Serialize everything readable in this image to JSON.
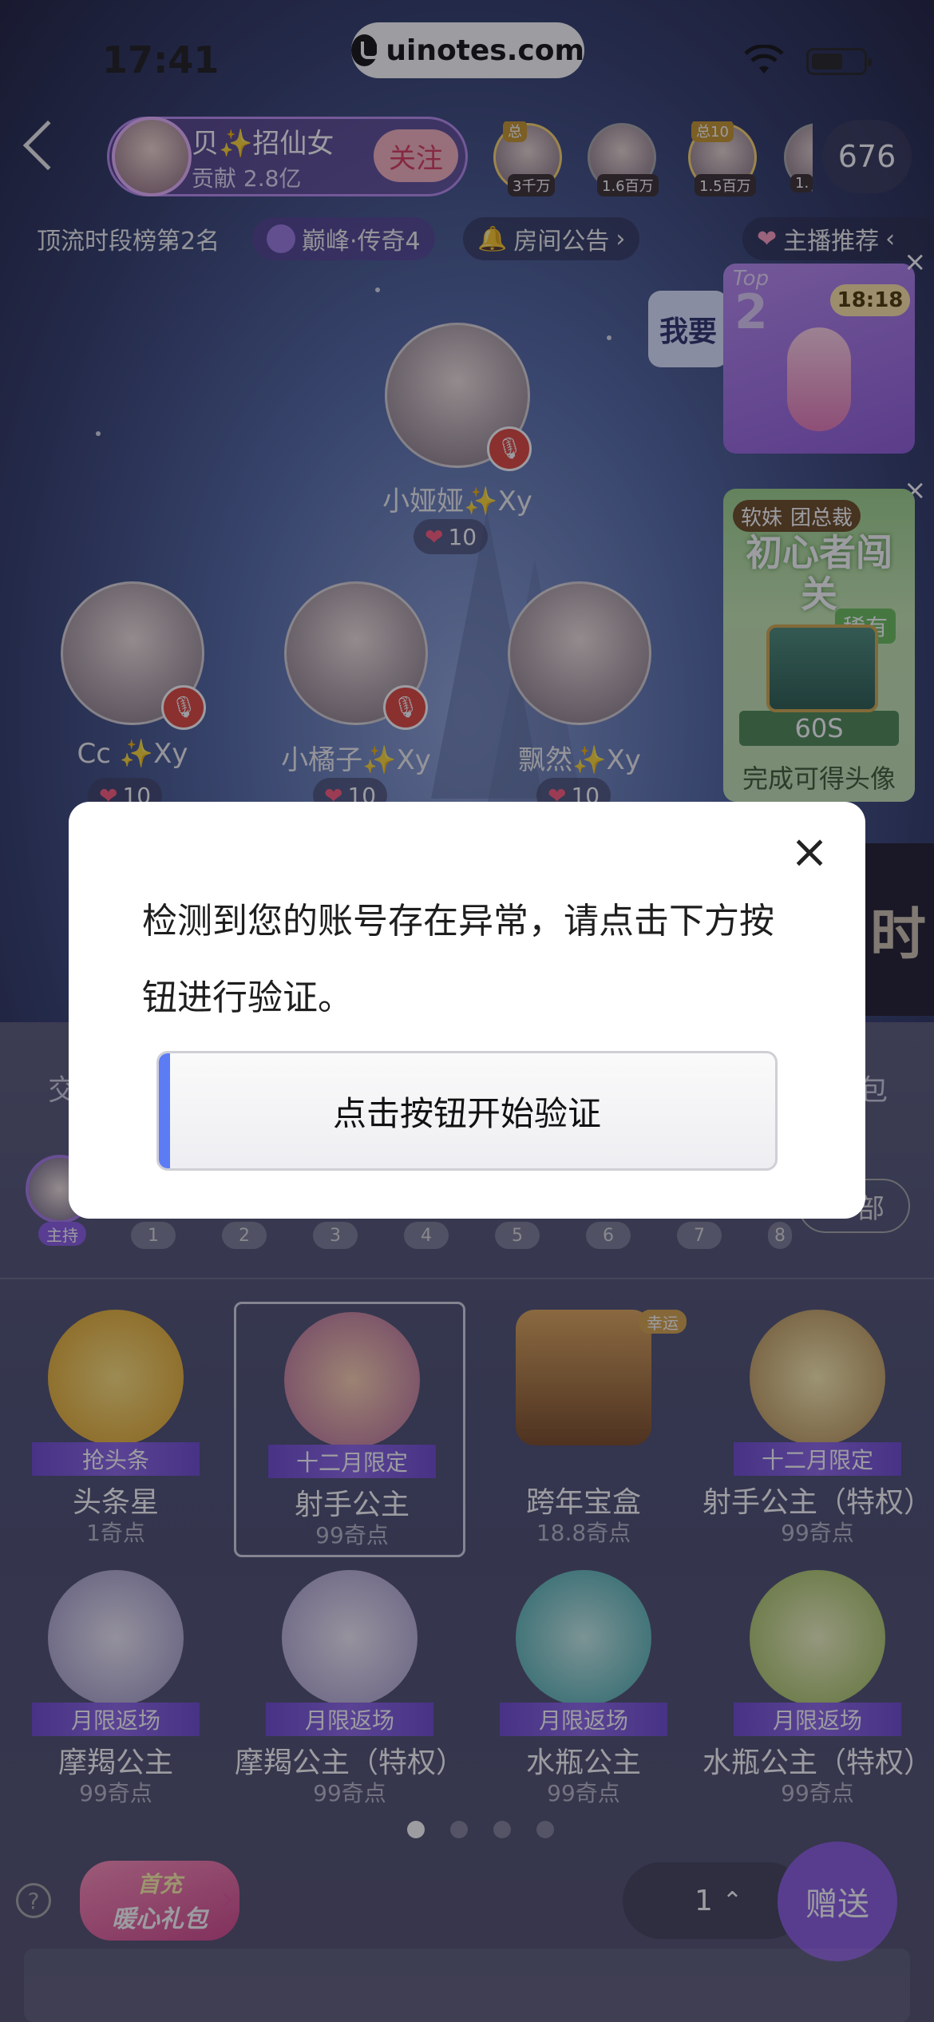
{
  "status_bar": {
    "time": "17:41"
  },
  "watermark": "uinotes.com",
  "header": {
    "host_name": "贝✨招仙女",
    "host_contribution": "贡献 2.8亿",
    "follow_label": "关注",
    "rank_badges": [
      "3千万",
      "1.6百万",
      "1.5百万",
      "1."
    ],
    "rank_tags": [
      "总",
      "",
      "总10",
      ""
    ],
    "viewer_count": "676"
  },
  "tags": {
    "rank_text": "顶流时段榜第2名",
    "level_text": "巅峰·传奇4",
    "announcement": "房间公告",
    "recommend": "主播推荐"
  },
  "banner": {
    "top_label": "Top",
    "top_rank": "2",
    "timer": "18:18",
    "want_text": "我要",
    "promo_title": "初心者闯关",
    "promo_caption": "软妹",
    "promo_caption2": "团总裁",
    "rarity": "稀有",
    "countdown": "60S",
    "promo_footer": "完成可得头像",
    "side_text": "时"
  },
  "seats": [
    {
      "name": "小娅娅✨Xy",
      "hearts": "10"
    },
    {
      "name": "Cc ✨Xy",
      "hearts": "10"
    },
    {
      "name": "小橘子✨Xy",
      "hearts": "10"
    },
    {
      "name": "飘然✨Xy",
      "hearts": "10"
    }
  ],
  "panel": {
    "tab_left": "交",
    "tab_right": "包",
    "host_tag": "主持",
    "seat_numbers": [
      "1",
      "2",
      "3",
      "4",
      "5",
      "6",
      "7",
      "8"
    ],
    "all_label": "部"
  },
  "gifts": [
    {
      "ribbon": "抢头条",
      "name": "头条星",
      "price": "1奇点",
      "color": "#f2c23a"
    },
    {
      "ribbon": "十二月限定",
      "name": "射手公主",
      "price": "99奇点",
      "color": "#e9a36b"
    },
    {
      "ribbon": "",
      "name": "跨年宝盒",
      "price": "18.8奇点",
      "color": "#c98a3c",
      "badge": "幸运"
    },
    {
      "ribbon": "十二月限定",
      "name": "射手公主（特权）",
      "price": "99奇点",
      "color": "#e4c06a"
    },
    {
      "ribbon": "月限返场",
      "name": "摩羯公主",
      "price": "99奇点",
      "color": "#cfc7e6"
    },
    {
      "ribbon": "月限返场",
      "name": "摩羯公主（特权）",
      "price": "99奇点",
      "color": "#d7cdea"
    },
    {
      "ribbon": "月限返场",
      "name": "水瓶公主",
      "price": "99奇点",
      "color": "#7fd3cf"
    },
    {
      "ribbon": "月限返场",
      "name": "水瓶公主（特权）",
      "price": "99奇点",
      "color": "#cfe08a"
    }
  ],
  "footer": {
    "promo_line1": "首充",
    "promo_line2": "暖心礼包",
    "quantity": "1",
    "send_label": "赠送"
  },
  "modal": {
    "message": "检测到您的账号存在异常，请点击下方按钮进行验证。",
    "button_label": "点击按钮开始验证"
  }
}
